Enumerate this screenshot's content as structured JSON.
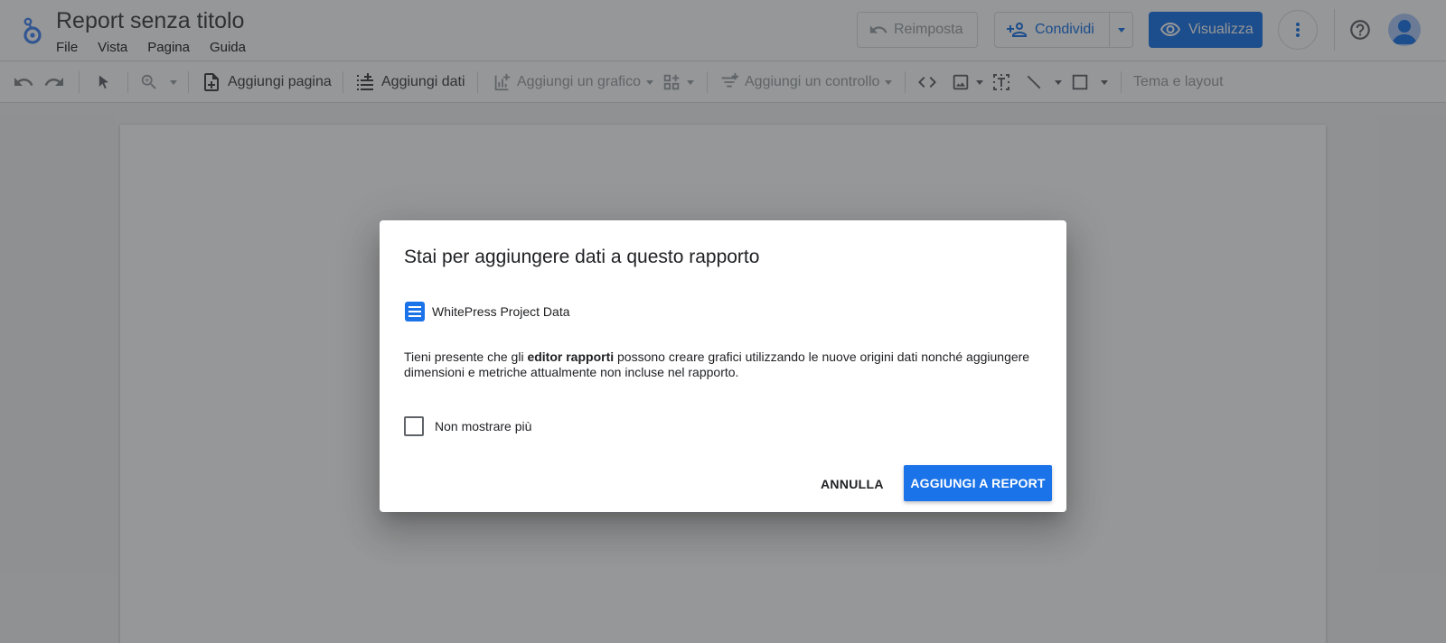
{
  "header": {
    "title": "Report senza titolo",
    "menu": [
      "File",
      "Vista",
      "Pagina",
      "Guida"
    ],
    "reset_label": "Reimposta",
    "share_label": "Condividi",
    "view_label": "Visualizza"
  },
  "toolbar": {
    "add_page": "Aggiungi pagina",
    "add_data": "Aggiungi dati",
    "add_chart": "Aggiungi un grafico",
    "add_control": "Aggiungi un controllo",
    "theme_layout": "Tema e layout"
  },
  "dialog": {
    "title": "Stai per aggiungere dati a questo rapporto",
    "data_source": "WhitePress Project Data",
    "body_before": "Tieni presente che gli ",
    "body_bold": "editor rapporti",
    "body_after": " possono creare grafici utilizzando le nuove origini dati nonché aggiungere dimensioni e metriche attualmente non incluse nel rapporto.",
    "checkbox_label": "Non mostrare più",
    "checkbox_checked": false,
    "cancel_label": "ANNULLA",
    "confirm_label": "AGGIUNGI A REPORT"
  },
  "colors": {
    "accent": "#1a73e8",
    "overlay": "rgba(32,33,36,0.47)",
    "disabled_text": "#9aa0a6"
  }
}
